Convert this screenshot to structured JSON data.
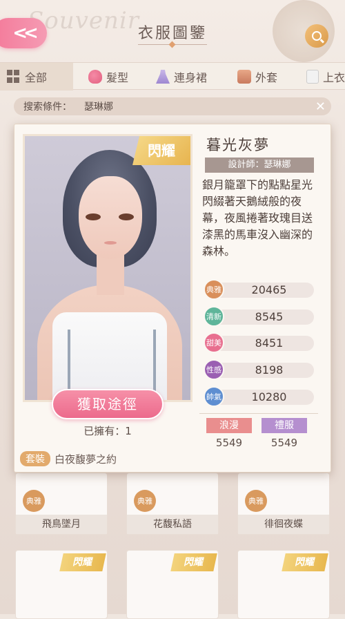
{
  "header": {
    "title": "衣服圖鑒",
    "bg_text": "Souvenir"
  },
  "tabs": [
    {
      "label": "全部",
      "active": true
    },
    {
      "label": "髮型"
    },
    {
      "label": "連身裙"
    },
    {
      "label": "外套"
    },
    {
      "label": "上衣"
    }
  ],
  "search": {
    "label": "搜索條件：",
    "value": "瑟琳娜"
  },
  "detail": {
    "name": "暮光灰夢",
    "designer": "設計師：瑟琳娜",
    "description": "銀月籠罩下的點點星光閃綴著天鵝絨般的夜幕，夜風捲著玫瑰目送漆黑的馬車沒入幽深的森林。",
    "shine_tag": "閃耀",
    "obtain_label": "獲取途徑",
    "owned": "已擁有：1",
    "set_tag": "套裝",
    "set_name": "白夜馥夢之約",
    "stats": [
      {
        "name": "典雅",
        "value": "20465",
        "color": "#d98f5b"
      },
      {
        "name": "清新",
        "value": "8545",
        "color": "#5fb59a"
      },
      {
        "name": "甜美",
        "value": "8451",
        "color": "#e86f8f"
      },
      {
        "name": "性感",
        "value": "8198",
        "color": "#9a5fb2"
      },
      {
        "name": "帥氣",
        "value": "10280",
        "color": "#5e8ed1"
      }
    ],
    "attributes": [
      {
        "label": "浪漫",
        "value": "5549",
        "color": "#e98e8e"
      },
      {
        "label": "禮服",
        "value": "5549",
        "color": "#b58fcf"
      }
    ]
  },
  "grid": [
    {
      "name": "飛鳥墜月",
      "badge": "典雅"
    },
    {
      "name": "花馥私語",
      "badge": "典雅"
    },
    {
      "name": "徘徊夜蝶",
      "badge": "典雅"
    },
    {
      "shine": "閃耀"
    },
    {
      "shine": "閃耀"
    },
    {
      "shine": "閃耀"
    }
  ]
}
